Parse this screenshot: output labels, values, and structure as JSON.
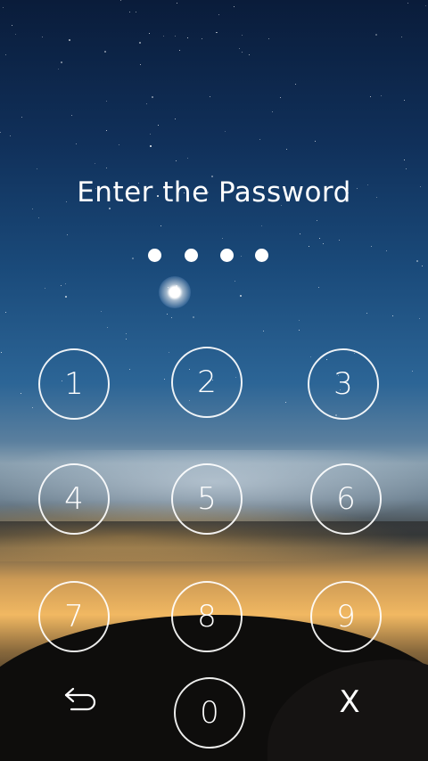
{
  "lock": {
    "title": "Enter the Password",
    "entered_count": 4,
    "keys": [
      "1",
      "2",
      "3",
      "4",
      "5",
      "6",
      "7",
      "8",
      "9",
      "0"
    ],
    "back_icon": "back-arrow-icon",
    "clear_label": "X"
  }
}
